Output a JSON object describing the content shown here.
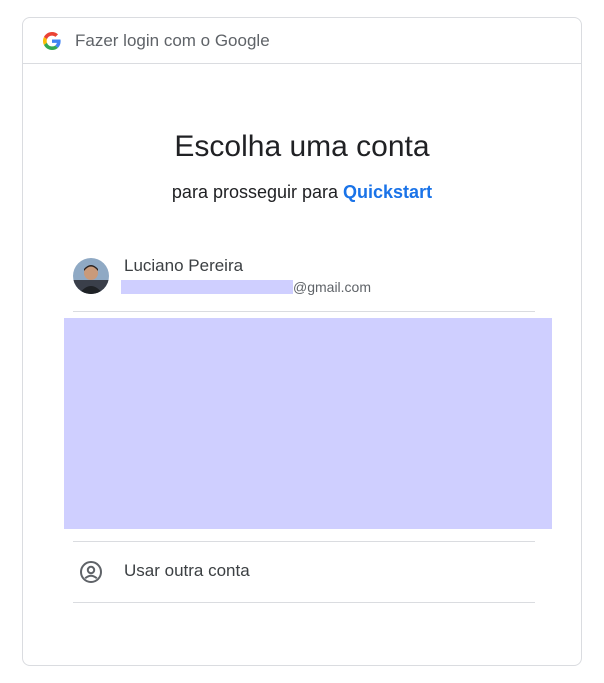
{
  "header": {
    "text": "Fazer login com o Google",
    "logo_icon": "google-g-icon"
  },
  "main": {
    "title": "Escolha uma conta",
    "subtitle_prefix": "para prosseguir para ",
    "app_name": "Quickstart"
  },
  "accounts": [
    {
      "name": "Luciano Pereira",
      "email_suffix": "@gmail.com",
      "avatar_icon": "user-avatar"
    }
  ],
  "other_account": {
    "label": "Usar outra conta",
    "icon": "account-circle-icon"
  },
  "colors": {
    "link": "#1a73e8",
    "border": "#dadce0",
    "redaction": "#cfcfff"
  }
}
